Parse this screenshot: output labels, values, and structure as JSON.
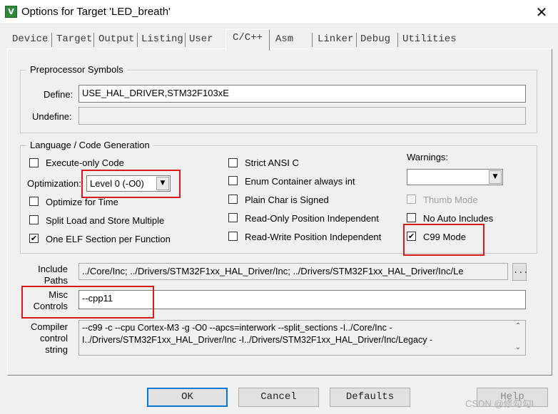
{
  "window": {
    "title": "Options for Target 'LED_breath'",
    "icon": "keil-uvision-icon",
    "close_glyph": "✕"
  },
  "tabs": [
    {
      "label": "Device"
    },
    {
      "label": "Target"
    },
    {
      "label": "Output"
    },
    {
      "label": "Listing"
    },
    {
      "label": "User"
    },
    {
      "label": "C/C++"
    },
    {
      "label": "Asm"
    },
    {
      "label": "Linker"
    },
    {
      "label": "Debug"
    },
    {
      "label": "Utilities"
    }
  ],
  "preprocessor": {
    "title": "Preprocessor Symbols",
    "define_label": "Define:",
    "define_value": "USE_HAL_DRIVER,STM32F103xE",
    "undefine_label": "Undefine:",
    "undefine_value": ""
  },
  "language": {
    "title": "Language / Code Generation",
    "execute_only": {
      "label": "Execute-only Code",
      "checked": false
    },
    "optimization_label": "Optimization:",
    "optimization_value": "Level 0 (-O0)",
    "optimize_time": {
      "label": "Optimize for Time",
      "checked": false
    },
    "split_load": {
      "label": "Split Load and Store Multiple",
      "checked": false
    },
    "one_elf": {
      "label": "One ELF Section per Function",
      "checked": true
    },
    "strict_ansi": {
      "label": "Strict ANSI C",
      "checked": false
    },
    "enum_container": {
      "label": "Enum Container always int",
      "checked": false
    },
    "plain_char": {
      "label": "Plain Char is Signed",
      "checked": false
    },
    "ro_pos": {
      "label": "Read-Only Position Independent",
      "checked": false
    },
    "rw_pos": {
      "label": "Read-Write Position Independent",
      "checked": false
    },
    "warnings_label": "Warnings:",
    "warnings_value": "",
    "thumb_mode": {
      "label": "Thumb Mode",
      "checked": false,
      "disabled": true
    },
    "no_auto_includes": {
      "label": "No Auto Includes",
      "checked": false
    },
    "c99_mode": {
      "label": "C99 Mode",
      "checked": true
    },
    "check_glyph": "✔"
  },
  "include": {
    "label_line1": "Include",
    "label_line2": "Paths",
    "value": "../Core/Inc;          ../Drivers/STM32F1xx_HAL_Driver/Inc;          ../Drivers/STM32F1xx_HAL_Driver/Inc/Le",
    "browse_label": "..."
  },
  "misc": {
    "label_line1": "Misc",
    "label_line2": "Controls",
    "value": "--cpp11"
  },
  "compiler": {
    "label_line1": "Compiler",
    "label_line2": "control",
    "label_line3": "string",
    "line1": "--c99 -c --cpu Cortex-M3 -g -O0 --apcs=interwork --split_sections -I../Core/Inc -",
    "line2": "I../Drivers/STM32F1xx_HAL_Driver/Inc -I../Drivers/STM32F1xx_HAL_Driver/Inc/Legacy -",
    "scroll_up": "⌃",
    "scroll_down": "⌄"
  },
  "buttons": {
    "ok": "OK",
    "cancel": "Cancel",
    "defaults": "Defaults",
    "help": "Help"
  },
  "watermark": "CSDN @修勾勾L",
  "colors": {
    "highlight_box": "#d9191b",
    "default_button_border": "#0078d7"
  }
}
